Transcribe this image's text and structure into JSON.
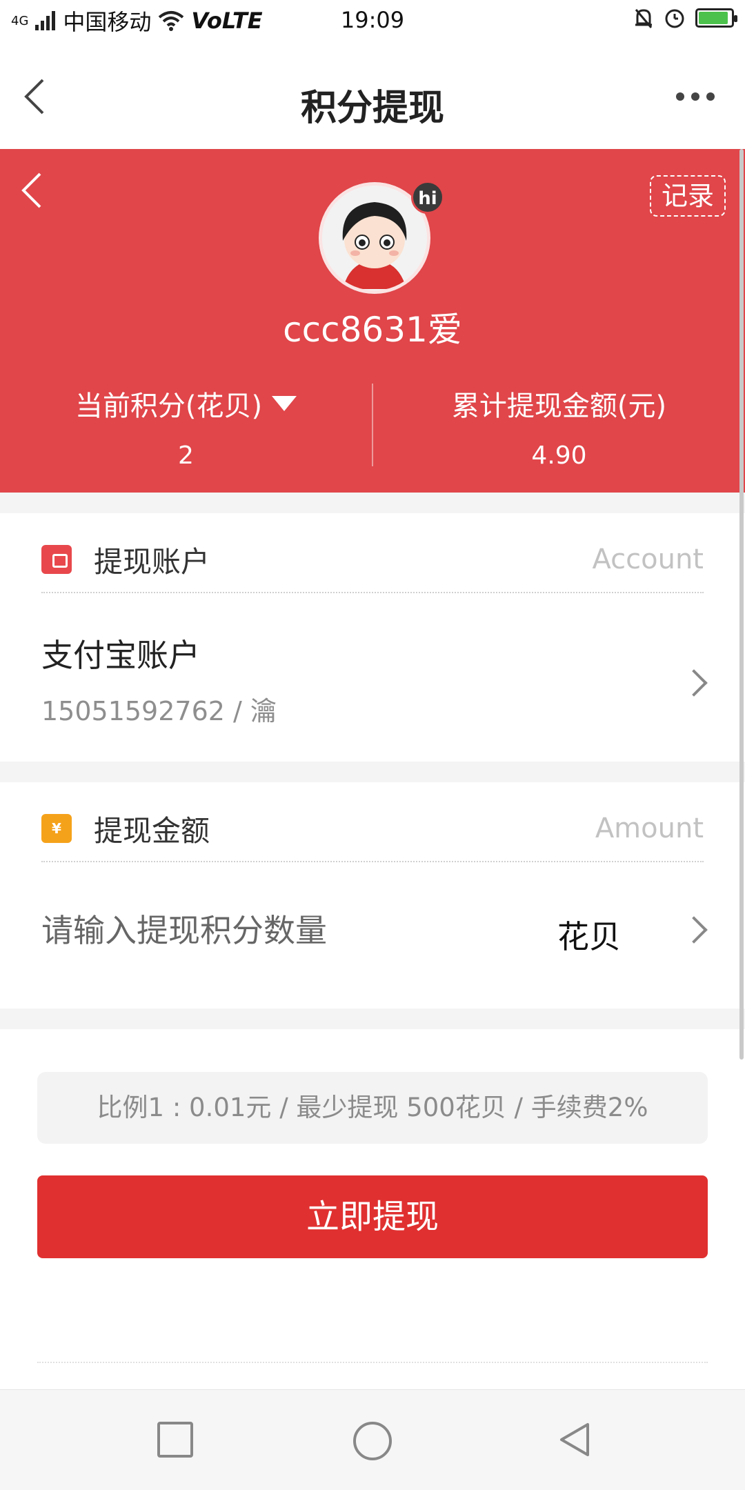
{
  "status_bar": {
    "network": "4G",
    "carrier": "中国移动",
    "volte": "VoLTE",
    "time": "19:09"
  },
  "header": {
    "title": "积分提现"
  },
  "profile": {
    "record_label": "记录",
    "badge": "hi",
    "username": "ccc8631爱",
    "stats": [
      {
        "label": "当前积分(花贝)",
        "value": "2"
      },
      {
        "label": "累计提现金额(元)",
        "value": "4.90"
      }
    ]
  },
  "account_section": {
    "title": "提现账户",
    "hint": "Account",
    "account_name": "支付宝账户",
    "account_detail": "15051592762 / 瀹"
  },
  "amount_section": {
    "title": "提现金额",
    "hint": "Amount",
    "icon_glyph": "¥",
    "placeholder": "请输入提现积分数量",
    "unit": "花贝"
  },
  "rate_text": "比例1 : 0.01元 / 最少提现 500花贝 / 手续费2%",
  "submit_label": "立即提现",
  "colors": {
    "brand_red": "#e0464a",
    "button_red": "#e03030",
    "wallet_icon": "#e8484c",
    "cash_icon": "#f5a21b"
  }
}
